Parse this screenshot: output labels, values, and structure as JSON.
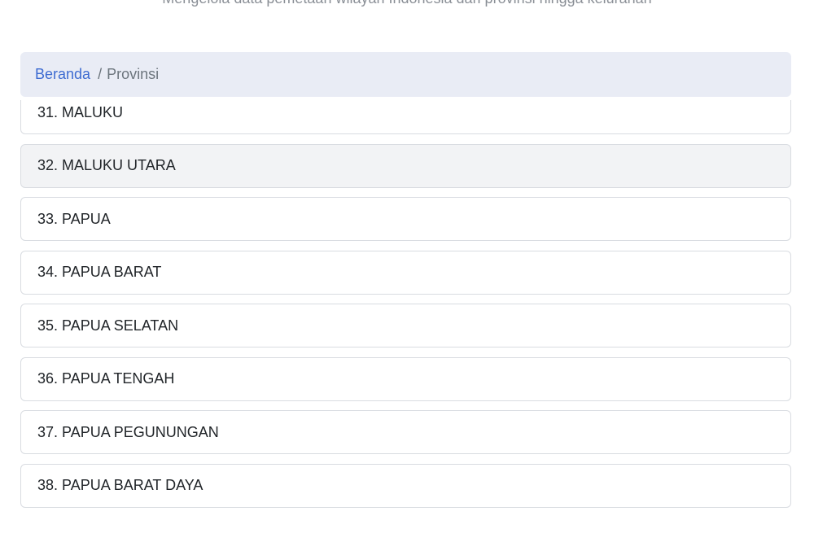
{
  "header": {
    "subtitle": "Mengelola data pemetaan wilayah Indonesia dari provinsi hingga kelurahan"
  },
  "breadcrumb": {
    "home": "Beranda",
    "separator": "/",
    "current": "Provinsi"
  },
  "provinces": [
    {
      "label": "31. MALUKU"
    },
    {
      "label": "32. MALUKU UTARA",
      "highlighted": true
    },
    {
      "label": "33. PAPUA"
    },
    {
      "label": "34. PAPUA BARAT"
    },
    {
      "label": "35. PAPUA SELATAN"
    },
    {
      "label": "36. PAPUA TENGAH"
    },
    {
      "label": "37. PAPUA PEGUNUNGAN"
    },
    {
      "label": "38. PAPUA BARAT DAYA"
    }
  ],
  "colors": {
    "link": "#3d6bd1",
    "breadcrumb_bg": "#e9ecf5",
    "highlight_bg": "#f2f3f5",
    "border": "#d9dce1"
  }
}
